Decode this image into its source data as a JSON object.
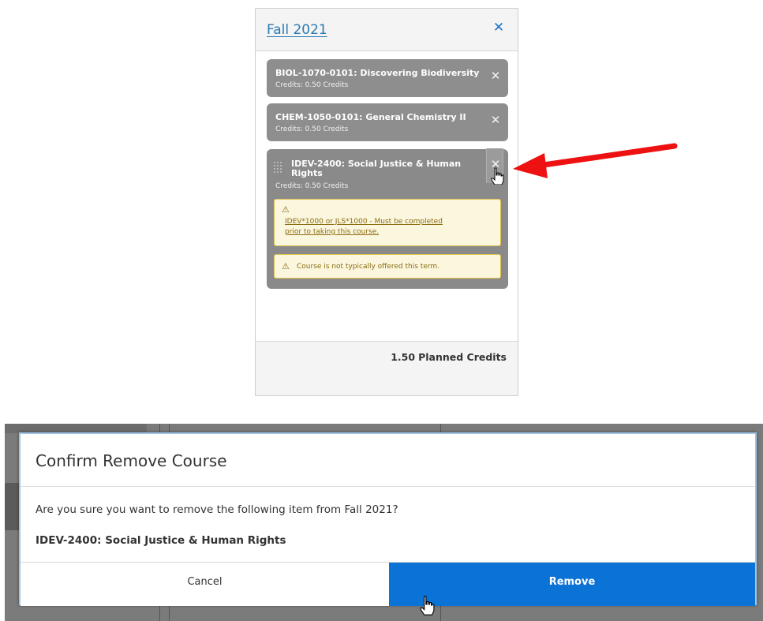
{
  "term_panel": {
    "title": "Fall 2021",
    "close_icon": "close-icon",
    "courses": [
      {
        "title": "BIOL-1070-0101: Discovering Biodiversity",
        "credits": "Credits: 0.50 Credits"
      },
      {
        "title": "CHEM-1050-0101: General Chemistry II",
        "credits": "Credits: 0.50 Credits"
      },
      {
        "title_line1": "IDEV-2400: Social Justice & Human",
        "title_line2": "Rights",
        "credits": "Credits: 0.50 Credits",
        "warnings": [
          {
            "line1": "IDEV*1000 or JLS*1000 - Must be completed",
            "line2": "prior to taking this course."
          },
          {
            "text": "Course is not typically offered this term."
          }
        ]
      }
    ],
    "planned_credits_value": "1.50",
    "planned_credits_label": "Planned Credits"
  },
  "dialog": {
    "title": "Confirm Remove Course",
    "question": "Are you sure you want to remove the following item from Fall 2021?",
    "item": "IDEV-2400: Social Justice & Human Rights",
    "cancel_label": "Cancel",
    "remove_label": "Remove"
  },
  "colors": {
    "accent": "#0c73d6",
    "link": "#2a7ab0",
    "card": "#8e8e8e",
    "warning_bg": "#fbf6de",
    "warning_border": "#e0c44c",
    "annotation_arrow": "#ee1111"
  }
}
